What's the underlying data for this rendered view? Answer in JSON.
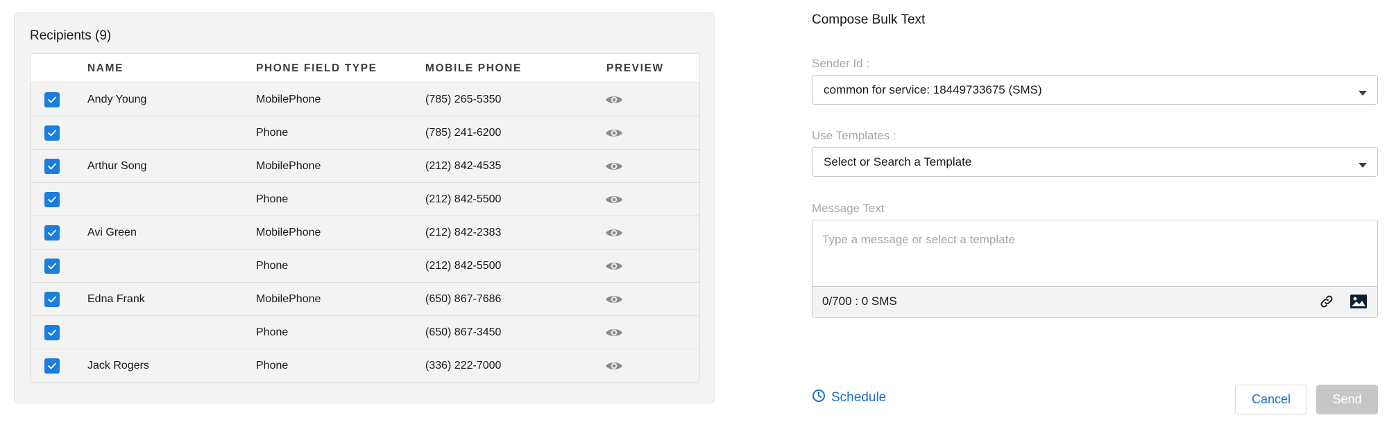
{
  "recipients": {
    "title": "Recipients (9)",
    "columns": {
      "name": "NAME",
      "phone_field_type": "PHONE FIELD TYPE",
      "mobile_phone": "MOBILE PHONE",
      "preview": "PREVIEW"
    },
    "rows": [
      {
        "checked": true,
        "name": "Andy Young",
        "type": "MobilePhone",
        "phone": "(785) 265-5350",
        "preview_icon": "eye-icon"
      },
      {
        "checked": true,
        "name": "",
        "type": "Phone",
        "phone": "(785) 241-6200",
        "preview_icon": "eye-icon"
      },
      {
        "checked": true,
        "name": "Arthur Song",
        "type": "MobilePhone",
        "phone": "(212) 842-4535",
        "preview_icon": "eye-icon"
      },
      {
        "checked": true,
        "name": "",
        "type": "Phone",
        "phone": "(212) 842-5500",
        "preview_icon": "eye-icon"
      },
      {
        "checked": true,
        "name": "Avi Green",
        "type": "MobilePhone",
        "phone": "(212) 842-2383",
        "preview_icon": "eye-icon"
      },
      {
        "checked": true,
        "name": "",
        "type": "Phone",
        "phone": "(212) 842-5500",
        "preview_icon": "eye-icon"
      },
      {
        "checked": true,
        "name": "Edna Frank",
        "type": "MobilePhone",
        "phone": "(650) 867-7686",
        "preview_icon": "eye-icon"
      },
      {
        "checked": true,
        "name": "",
        "type": "Phone",
        "phone": "(650) 867-3450",
        "preview_icon": "eye-icon"
      },
      {
        "checked": true,
        "name": "Jack Rogers",
        "type": "Phone",
        "phone": "(336) 222-7000",
        "preview_icon": "eye-icon"
      }
    ]
  },
  "compose": {
    "title": "Compose Bulk Text",
    "sender_label": "Sender Id :",
    "sender_value": "common for service: 18449733675 (SMS)",
    "template_label": "Use Templates :",
    "template_value": "Select or Search a Template",
    "message_label": "Message Text",
    "message_placeholder": "Type a message or select a template",
    "counter": "0/700 : 0 SMS",
    "schedule_label": "Schedule",
    "cancel_label": "Cancel",
    "send_label": "Send"
  },
  "colors": {
    "accent": "#1b7ddc",
    "link": "#1b6fc7",
    "panel_bg": "#f3f3f3",
    "send_disabled": "#c9c7c5"
  }
}
